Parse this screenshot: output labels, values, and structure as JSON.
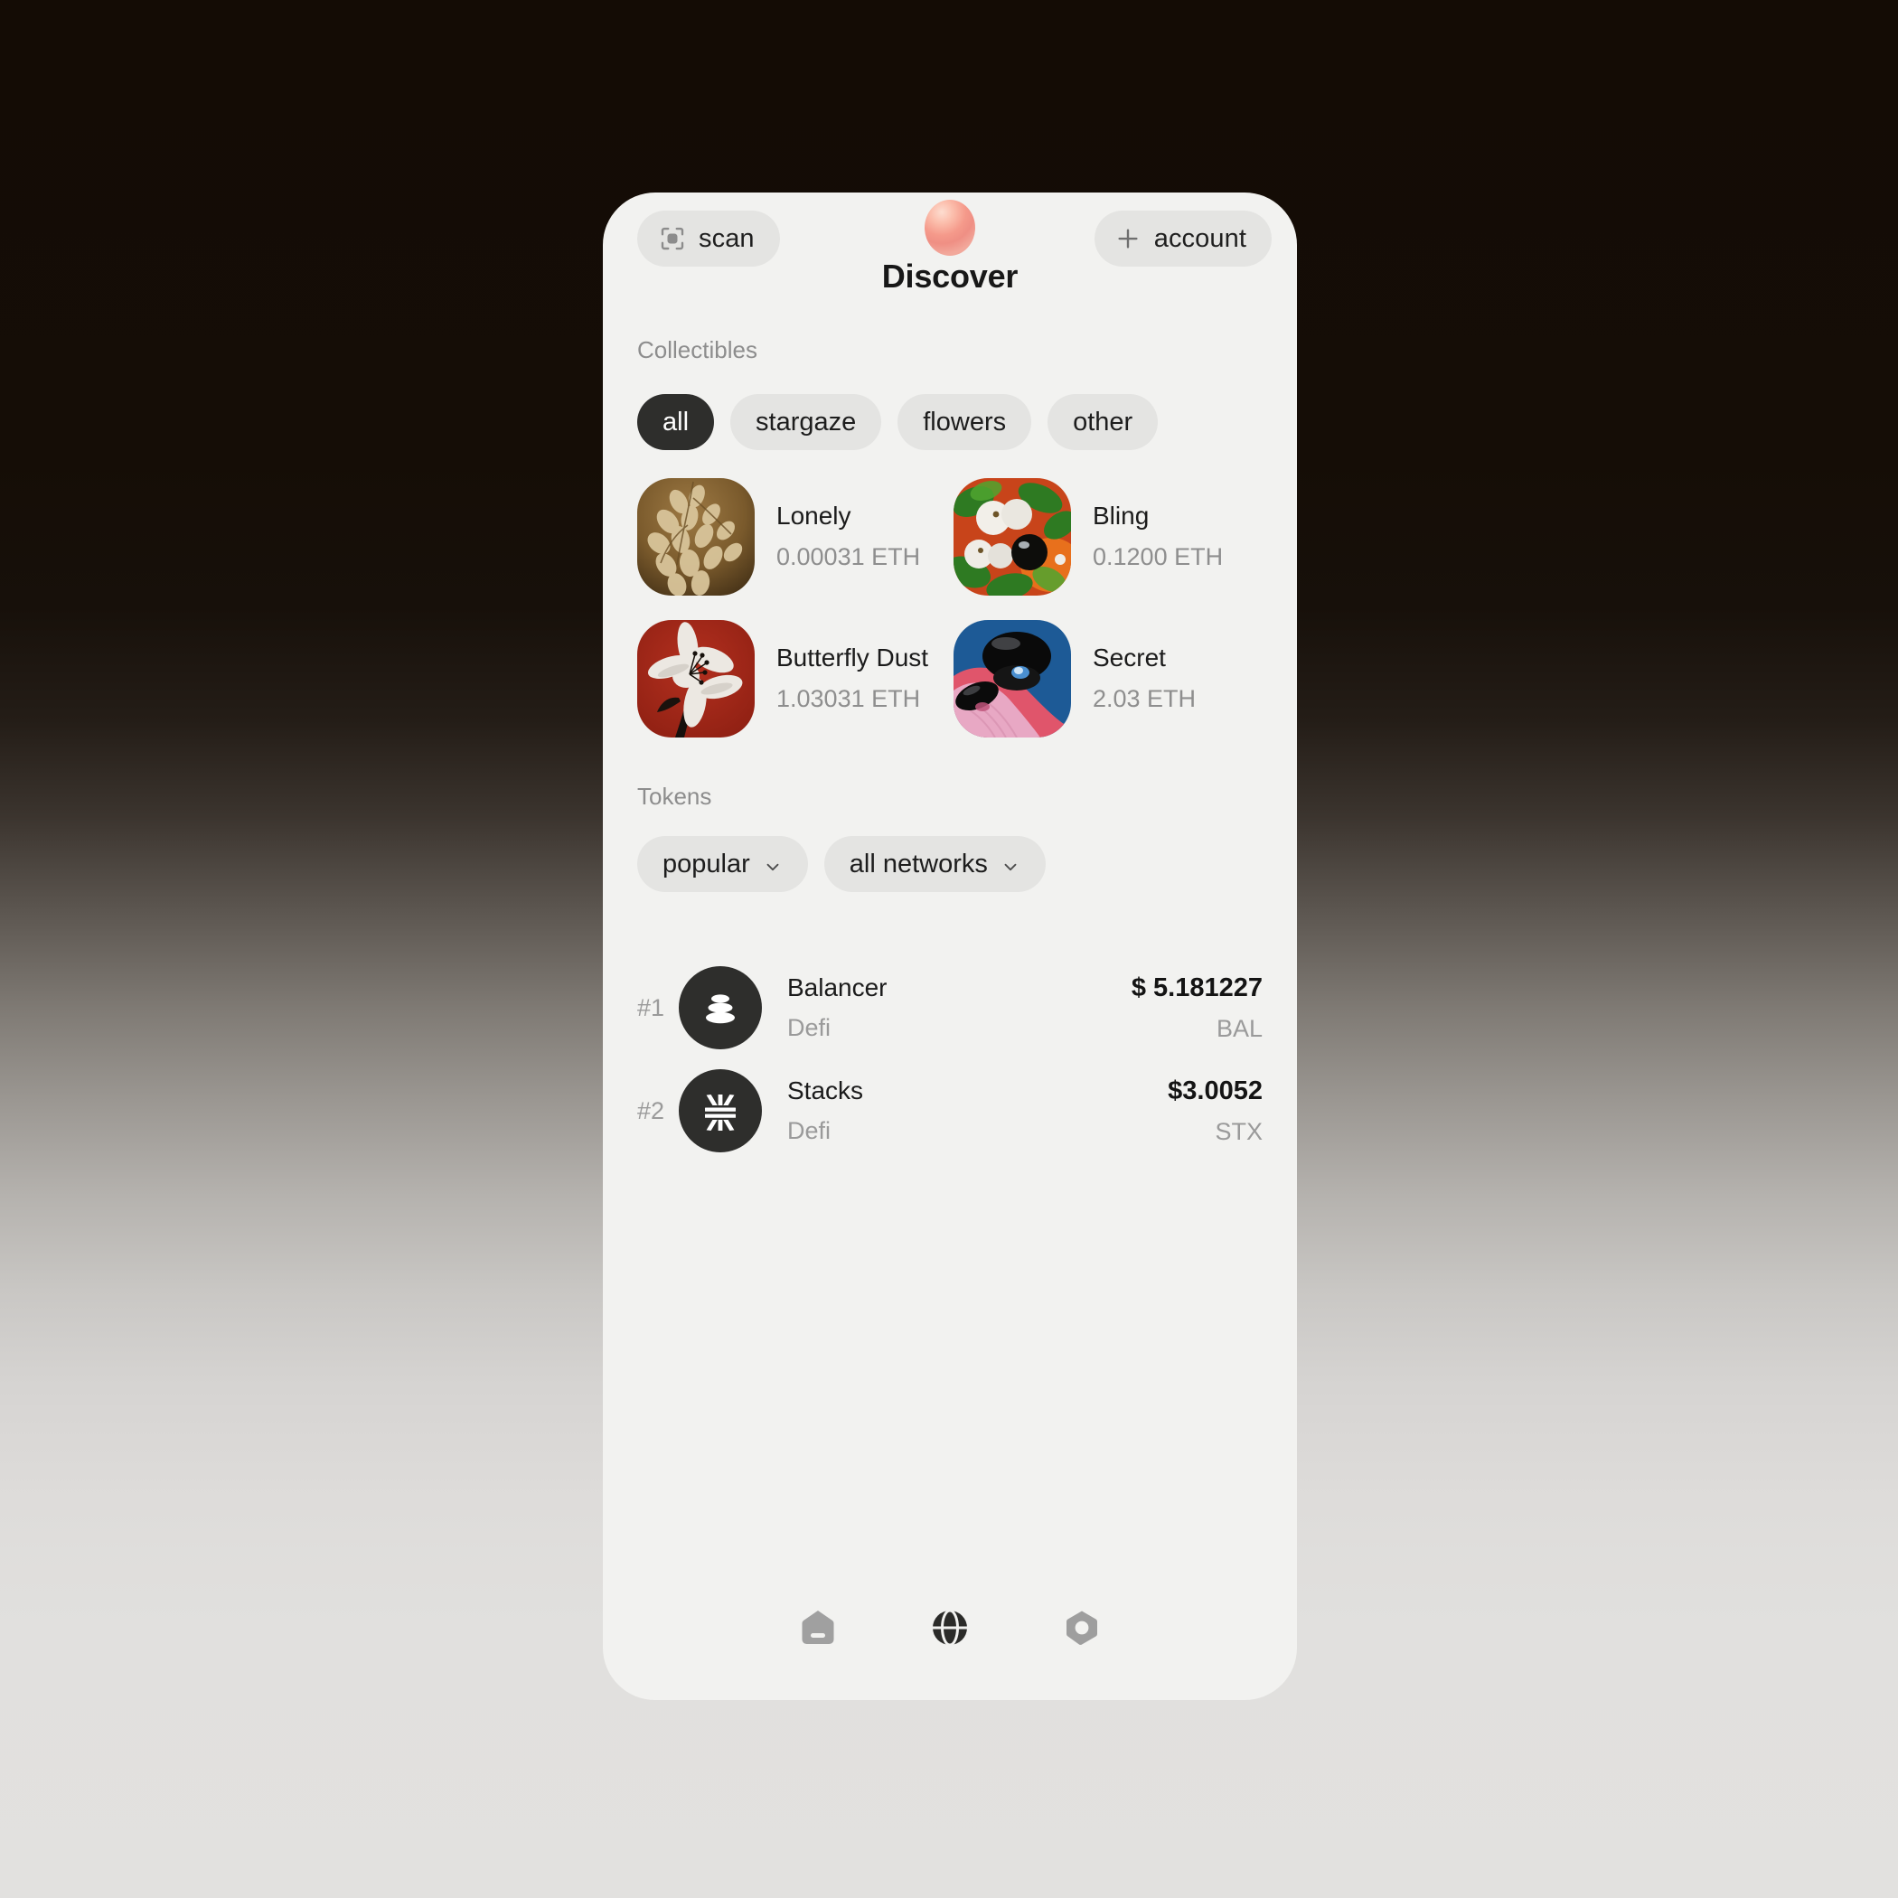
{
  "app": {
    "title": "Discover",
    "theme": {
      "surface": "#f2f2f0",
      "chip": "#e4e4e2",
      "chip_active": "#2e2e2c",
      "text": "#1b1b1b",
      "muted": "#8e8e8e",
      "accent_blob": "#f59a8b",
      "background_top": "#140c05",
      "background_bottom": "#e2e1df"
    }
  },
  "topbar": {
    "scan_label": "scan",
    "scan_icon": "scan-icon",
    "account_label": "account",
    "account_icon": "plus-icon",
    "avatar_icon": "avatar-blob"
  },
  "collectibles": {
    "section_label": "Collectibles",
    "filters": [
      {
        "label": "all",
        "active": true
      },
      {
        "label": "stargaze",
        "active": false
      },
      {
        "label": "flowers",
        "active": false
      },
      {
        "label": "other",
        "active": false
      }
    ],
    "items": [
      {
        "name": "Lonely",
        "price": "0.00031 ETH",
        "art": "sepia-leaves"
      },
      {
        "name": "Bling",
        "price": "0.1200 ETH",
        "art": "white-berries"
      },
      {
        "name": "Butterfly Dust",
        "price": "1.03031 ETH",
        "art": "red-lily"
      },
      {
        "name": "Secret",
        "price": "2.03 ETH",
        "art": "blue-gloss"
      }
    ]
  },
  "tokens": {
    "section_label": "Tokens",
    "filters": [
      {
        "label": "popular",
        "icon": "chevron-down-icon"
      },
      {
        "label": "all networks",
        "icon": "chevron-down-icon"
      }
    ],
    "rows": [
      {
        "rank": "#1",
        "name": "Balancer",
        "category": "Defi",
        "price": "$ 5.181227",
        "symbol": "BAL",
        "logo": "balancer-logo"
      },
      {
        "rank": "#2",
        "name": "Stacks",
        "category": "Defi",
        "price": "$3.0052",
        "symbol": "STX",
        "logo": "stacks-logo"
      }
    ]
  },
  "bottom_nav": [
    {
      "icon": "home-icon",
      "active": false
    },
    {
      "icon": "globe-icon",
      "active": true
    },
    {
      "icon": "hex-nut-icon",
      "active": false
    }
  ]
}
